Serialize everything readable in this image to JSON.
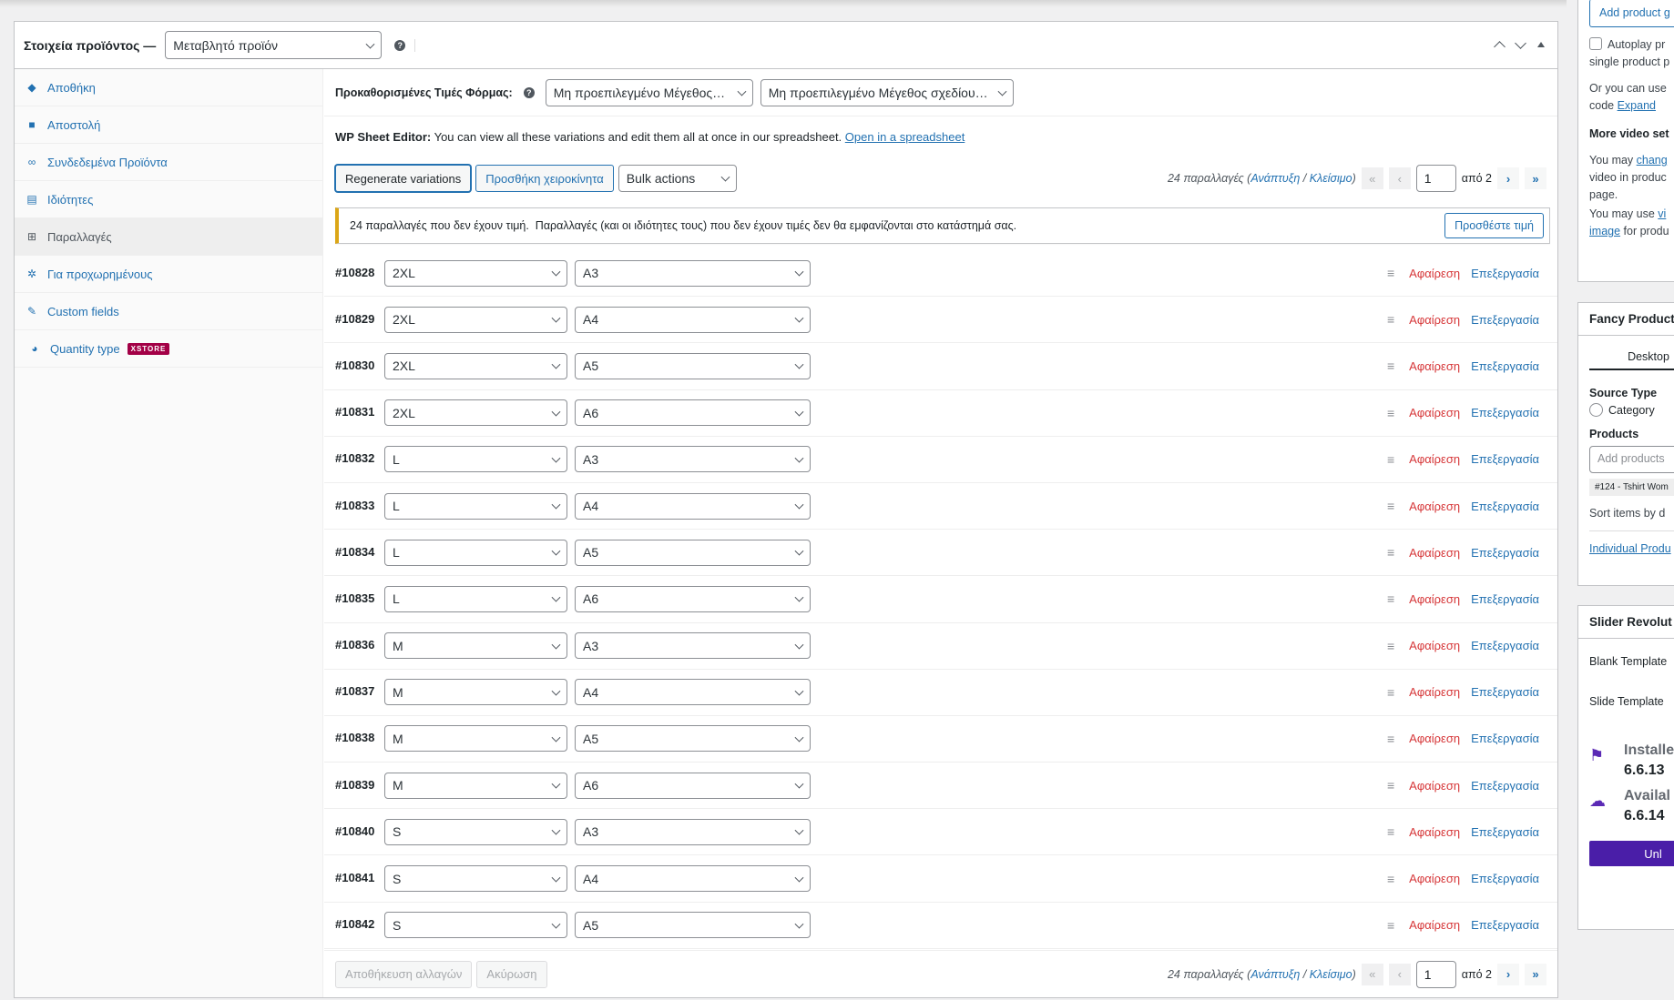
{
  "header": {
    "title": "Στοιχεία προϊόντος —",
    "product_type": "Μεταβλητό προϊόν",
    "help_icon": "?"
  },
  "tabs": [
    {
      "label": "Αποθήκη",
      "icon": "tag-icon"
    },
    {
      "label": "Αποστολή",
      "icon": "truck-icon"
    },
    {
      "label": "Συνδεδεμένα Προϊόντα",
      "icon": "link-icon"
    },
    {
      "label": "Ιδιότητες",
      "icon": "list-icon"
    },
    {
      "label": "Παραλλαγές",
      "icon": "grid-icon",
      "active": true
    },
    {
      "label": "Για προχωρημένους",
      "icon": "gear-icon"
    },
    {
      "label": "Custom fields",
      "icon": "wrench-icon"
    },
    {
      "label": "Quantity type",
      "icon": "pie-icon",
      "badge": "XSTORE"
    }
  ],
  "defaults": {
    "label": "Προκαθορισμένες Τιμές Φόρμας:",
    "select1": "Μη προεπιλεγμένο Μέγεθος…",
    "select2": "Μη προεπιλεγμένο Μέγεθος σχεδίου…"
  },
  "wpse": {
    "bold": "WP Sheet Editor:",
    "text": " You can view all these variations and edit them all at once in our spreadsheet. ",
    "link": "Open in a spreadsheet"
  },
  "toolbar": {
    "regenerate": "Regenerate variations",
    "add_manual": "Προσθήκη χειροκίνητα",
    "bulk_actions": "Bulk actions"
  },
  "pager": {
    "count": "24 παραλλαγές",
    "expand": "Ανάπτυξη",
    "sep": "/",
    "close": "Κλείσιμο",
    "first": "«",
    "prev": "‹",
    "page": "1",
    "of": "από 2",
    "next": "›",
    "last": "»"
  },
  "notice": {
    "text": "24 παραλλαγές που δεν έχουν τιμή.  Παραλλαγές (και οι ιδιότητες τους) που δεν έχουν τιμές δεν θα εμφανίζονται στο κατάστημά σας.",
    "button": "Προσθέστε τιμή"
  },
  "variation_actions": {
    "remove": "Αφαίρεση",
    "edit": "Επεξεργασία"
  },
  "variations": [
    {
      "id": "#10828",
      "size": "2XL",
      "design": "A3"
    },
    {
      "id": "#10829",
      "size": "2XL",
      "design": "A4"
    },
    {
      "id": "#10830",
      "size": "2XL",
      "design": "A5"
    },
    {
      "id": "#10831",
      "size": "2XL",
      "design": "A6"
    },
    {
      "id": "#10832",
      "size": "L",
      "design": "A3"
    },
    {
      "id": "#10833",
      "size": "L",
      "design": "A4"
    },
    {
      "id": "#10834",
      "size": "L",
      "design": "A5"
    },
    {
      "id": "#10835",
      "size": "L",
      "design": "A6"
    },
    {
      "id": "#10836",
      "size": "M",
      "design": "A3"
    },
    {
      "id": "#10837",
      "size": "M",
      "design": "A4"
    },
    {
      "id": "#10838",
      "size": "M",
      "design": "A5"
    },
    {
      "id": "#10839",
      "size": "M",
      "design": "A6"
    },
    {
      "id": "#10840",
      "size": "S",
      "design": "A3"
    },
    {
      "id": "#10841",
      "size": "S",
      "design": "A4"
    },
    {
      "id": "#10842",
      "size": "S",
      "design": "A5"
    }
  ],
  "footer": {
    "save": "Αποθήκευση αλλαγών",
    "cancel": "Ακύρωση"
  },
  "right": {
    "video": {
      "add_button": "Add product g",
      "autoplay_1": "Autoplay pr",
      "autoplay_2": "single product p",
      "or_use": "Or you can use",
      "code": "code ",
      "expand": "Expand",
      "more_title": "More video set",
      "may_change_1": "You may ",
      "may_change_link": "chang",
      "may_change_2": "video in produc",
      "may_change_3": "page.",
      "may_use_1": "You may use ",
      "may_use_link": "vi",
      "may_use_link2": "image",
      "may_use_2": " for produ"
    },
    "fancy": {
      "title": "Fancy Product",
      "tab": "Desktop",
      "source_type": "Source Type",
      "category": "Category",
      "products": "Products",
      "add_placeholder": "Add products",
      "chip": "#124 - Tshirt Wom",
      "sort": "Sort items by d",
      "individual": "Individual Produ"
    },
    "slider": {
      "title": "Slider Revolut",
      "blank": "Blank Template",
      "slide": "Slide Template",
      "installed_label": "Installe",
      "installed_version": "6.6.13",
      "available_label": "Availal",
      "available_version": "6.6.14",
      "unlock": "Unl"
    }
  },
  "colors": {
    "accent": "#2271b1",
    "remove": "#d63638",
    "notice": "#dba617",
    "badge": "#a30046",
    "slider_purple": "#4a1ea8"
  }
}
